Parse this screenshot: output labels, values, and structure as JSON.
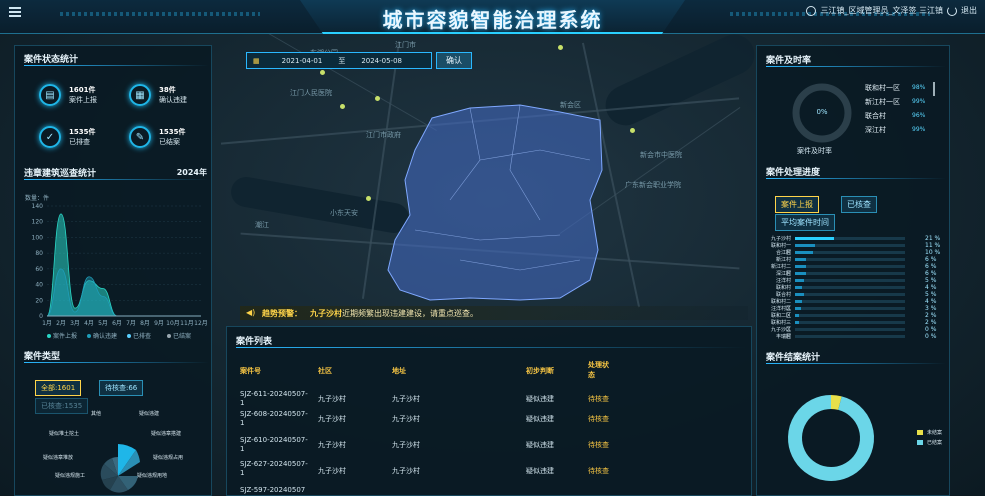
{
  "header": {
    "title": "城市容貌智能治理系统",
    "user_text": "三江镇_区域管理员_文泽签 三江镇",
    "logout": "退出"
  },
  "left": {
    "status_title": "案件状态统计",
    "stats": [
      {
        "value": "1601件",
        "label": "案件上报",
        "icon": "report-icon"
      },
      {
        "value": "38件",
        "label": "确认违建",
        "icon": "confirm-icon"
      },
      {
        "value": "1535件",
        "label": "已排查",
        "icon": "shield-icon"
      },
      {
        "value": "1535件",
        "label": "已结案",
        "icon": "document-icon"
      }
    ],
    "patrol_title": "违章建筑巡查统计",
    "patrol_year": "2024年",
    "type_title": "案件类型",
    "type_buttons": [
      "全部:1601",
      "待核查:66",
      "已核查:1535"
    ],
    "type_labels": [
      "其他",
      "疑似违建",
      "疑似堆土挖土",
      "疑似违章搭建",
      "疑似违章堆放",
      "疑似违规占用",
      "疑似违规施工",
      "疑似违规用地"
    ]
  },
  "center": {
    "date_start": "2021-04-01",
    "date_sep": "至",
    "date_end": "2024-05-08",
    "confirm": "确认",
    "alert_prefix": "趋势预警：",
    "alert_village": "九子沙村",
    "alert_text": "近期频繁出现违建建设，请重点巡查。",
    "case_title": "案件列表",
    "columns": [
      "案件号",
      "社区",
      "地址",
      "初步判断",
      "处理状态"
    ],
    "rows": [
      {
        "id": "SJZ-611-20240507-1",
        "community": "九子沙村",
        "address": "九子沙村",
        "judge": "疑似违建",
        "status": "待核查"
      },
      {
        "id": "SJZ-608-20240507-1",
        "community": "九子沙村",
        "address": "九子沙村",
        "judge": "疑似违建",
        "status": "待核查"
      },
      {
        "id": "SJZ-610-20240507-1",
        "community": "九子沙村",
        "address": "九子沙村",
        "judge": "疑似违建",
        "status": "待核查"
      },
      {
        "id": "SJZ-627-20240507-1",
        "community": "九子沙村",
        "address": "九子沙村",
        "judge": "疑似违建",
        "status": "待核查"
      },
      {
        "id": "SJZ-597-20240507",
        "community": "",
        "address": "",
        "judge": "",
        "status": ""
      }
    ]
  },
  "right": {
    "rate_title": "案件及时率",
    "rate_center": "0%",
    "rate_caption": "案件及时率",
    "rates": [
      {
        "name": "联和村一区",
        "value": "98%"
      },
      {
        "name": "新江村一区",
        "value": "99%"
      },
      {
        "name": "联合村",
        "value": "96%"
      },
      {
        "name": "深江村",
        "value": "99%"
      }
    ],
    "progress_title": "案件处理进度",
    "progress_buttons": [
      "案件上报",
      "已核查",
      "平均案件时间"
    ],
    "close_title": "案件结案统计",
    "close_legend": [
      "未结案",
      "已结案"
    ]
  },
  "chart_data": [
    {
      "type": "area",
      "ylabel": "数量：件",
      "categories": [
        "1月",
        "2月",
        "3月",
        "4月",
        "5月",
        "6月",
        "7月",
        "8月",
        "9月",
        "10月",
        "11月",
        "12月"
      ],
      "ylim": [
        0,
        140
      ],
      "yticks": [
        0,
        20,
        40,
        60,
        80,
        100,
        120,
        140
      ],
      "series": [
        {
          "name": "案件上报",
          "values": [
            0,
            130,
            10,
            45,
            35,
            0,
            0,
            0,
            0,
            0,
            0,
            0
          ]
        },
        {
          "name": "确认违建",
          "values": [
            0,
            60,
            5,
            50,
            25,
            0,
            0,
            0,
            0,
            0,
            0,
            0
          ]
        },
        {
          "name": "已排查",
          "values": [
            0,
            0,
            0,
            0,
            0,
            0,
            0,
            0,
            0,
            0,
            0,
            0
          ]
        },
        {
          "name": "已结案",
          "values": [
            0,
            0,
            0,
            0,
            0,
            0,
            0,
            0,
            0,
            0,
            0,
            0
          ]
        }
      ],
      "colors": [
        "#2ad6c6",
        "#1f9db8",
        "#5bd0ff",
        "#9aa8b0"
      ]
    },
    {
      "type": "bar",
      "orientation": "horizontal",
      "categories": [
        "九子沙村",
        "联和村一区",
        "合江村",
        "新江村",
        "新江村二区",
        "深江村",
        "汪洋村",
        "联和村",
        "联合村",
        "联和村二区",
        "汪洋村二区",
        "联和二区",
        "联和村三区",
        "九子沙二区",
        "丰瑞村"
      ],
      "values": [
        21,
        11,
        10,
        6,
        6,
        6,
        5,
        4,
        5,
        4,
        3,
        2,
        2,
        0,
        0
      ],
      "value_labels": [
        "21 %",
        "11 %",
        "10 %",
        "6 %",
        "6 %",
        "6 %",
        "5 %",
        "4 %",
        "5 %",
        "4 %",
        "3 %",
        "2 %",
        "2 %",
        "0 %",
        "0 %"
      ]
    },
    {
      "type": "pie",
      "categories": [
        "未结案",
        "已结案"
      ],
      "values": [
        4,
        96
      ],
      "colors": [
        "#e8e04a",
        "#6bd6e8"
      ]
    }
  ]
}
